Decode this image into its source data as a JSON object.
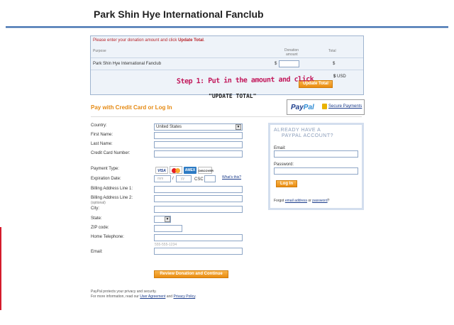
{
  "header": {
    "title": "Park Shin Hye International Fanclub"
  },
  "donation": {
    "message_pre": "Please enter your donation amount and click ",
    "message_bold": "Update Total",
    "message_post": ".",
    "col_purpose": "Purpose",
    "col_amount_1": "Donation",
    "col_amount_2": "amount",
    "col_total": "Total",
    "purpose": "Park Shin Hye International Fanclub",
    "currency_symbol": "$",
    "amount_value": "",
    "total_value": "$",
    "usd_symbol": "$",
    "usd_label": "USD",
    "update_button": "Update Total"
  },
  "annotation": {
    "step1": "Step 1: Put in the amount and click",
    "step1_cont": "\"UPDATE TOTAL\""
  },
  "payment": {
    "title": "Pay with Credit Card or Log In",
    "paypal_pay": "Pay",
    "paypal_pal": "Pal",
    "secure_label": "Secure Payments"
  },
  "form": {
    "country_label": "Country:",
    "country_value": "United States",
    "first_name_label": "First Name:",
    "last_name_label": "Last Name:",
    "card_number_label": "Credit Card Number:",
    "payment_type_label": "Payment Type:",
    "cards": [
      "VISA",
      "AMEX",
      "DISCOVER"
    ],
    "expiration_label": "Expiration Date:",
    "exp_month_placeholder": "mm",
    "exp_slash": "/",
    "exp_year_placeholder": "yy",
    "csc_label": "CSC",
    "whats_this": "What's this?",
    "billing1_label": "Billing Address Line 1:",
    "billing2_label": "Billing Address Line 2:",
    "billing2_optional": "(optional)",
    "city_label": "City:",
    "state_label": "State:",
    "zip_label": "ZIP code:",
    "phone_label": "Home Telephone:",
    "phone_placeholder": "555-555-1234",
    "email_label": "Email:",
    "review_button": "Review Donation and Continue"
  },
  "login": {
    "heading_1": "ALREADY HAVE A",
    "heading_2": "PAYPAL ACCOUNT?",
    "email_label": "Email:",
    "password_label": "Password:",
    "login_button": "Log In",
    "forgot_pre": "Forgot ",
    "forgot_email": "email address",
    "forgot_or": " or ",
    "forgot_password": "password",
    "forgot_post": "?"
  },
  "footer": {
    "line1": "PayPal protects your privacy and security.",
    "line2_pre": "For more information, read our ",
    "user_agreement": "User Agreement",
    "line2_and": " and ",
    "privacy_policy": "Privacy Policy",
    "line2_post": "."
  },
  "colors": {
    "accent_orange": "#e58a13",
    "header_blue": "#3f70b0",
    "error_red": "#b8242a",
    "annotation_pink": "#c2185b"
  }
}
